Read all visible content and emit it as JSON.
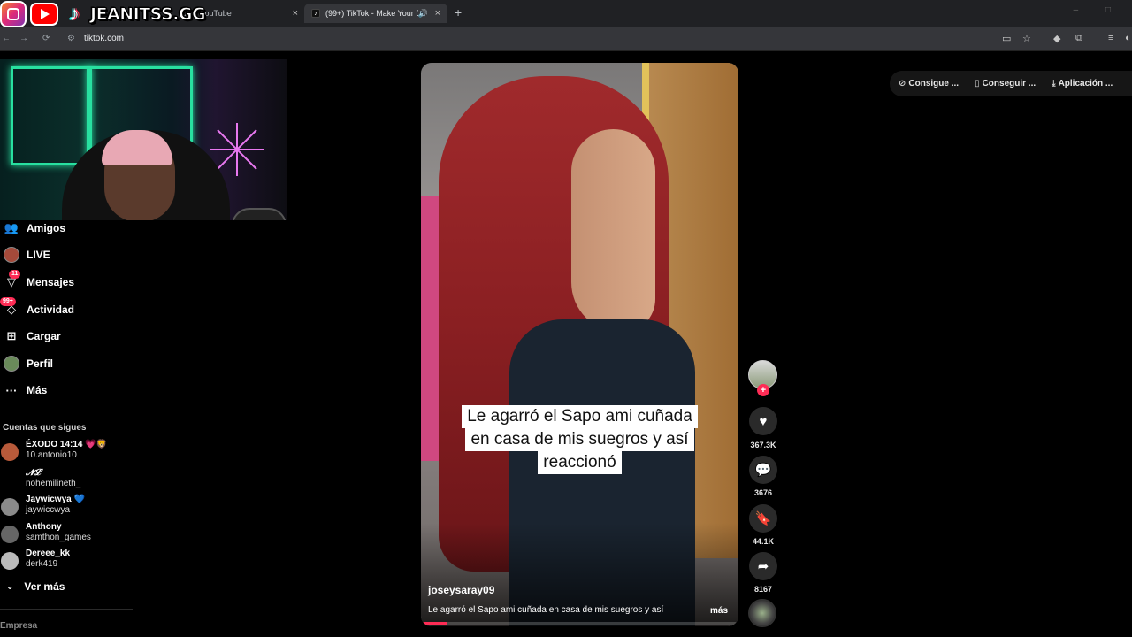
{
  "browser": {
    "tabs": [
      {
        "label": "(532) YouTube",
        "close": "×"
      },
      {
        "label": "(99+) TikTok - Make Your Da",
        "close": "×",
        "favicon": "♪"
      }
    ],
    "new_tab": "+",
    "url": "tiktok.com"
  },
  "overlay": {
    "brand": "JEANITSS.GG"
  },
  "sidebar": {
    "items": [
      {
        "label": "Amigos",
        "icon": "friends-icon"
      },
      {
        "label": "LIVE",
        "icon": "live-icon"
      },
      {
        "label": "Mensajes",
        "icon": "messages-icon",
        "badge": "11"
      },
      {
        "label": "Actividad",
        "icon": "activity-icon",
        "badge": "99+"
      },
      {
        "label": "Cargar",
        "icon": "upload-icon"
      },
      {
        "label": "Perfil",
        "icon": "profile-icon"
      },
      {
        "label": "Más",
        "icon": "more-icon"
      }
    ],
    "following_title": "Cuentas que sigues",
    "following": [
      {
        "name": "ÉXODO 14:14 💗🦁",
        "handle": "10.antonio10"
      },
      {
        "name": "𝓝𝓛",
        "handle": "nohemilineth_"
      },
      {
        "name": "Jaywicwya 💙",
        "handle": "jaywiccwya"
      },
      {
        "name": "Anthony",
        "handle": "samthon_games"
      },
      {
        "name": "Dereee_kk",
        "handle": "derk419"
      }
    ],
    "see_more": "Ver más",
    "footer": "Empresa"
  },
  "video": {
    "caption_lines": [
      "Le agarró el Sapo ami cuñada",
      "en casa de mis suegros y así",
      "reaccionó"
    ],
    "username": "joseysaray09",
    "description": "Le agarró el Sapo ami cuñada en casa de mis suegros y así",
    "more": "más",
    "progress": 0.08
  },
  "actions": {
    "likes": "367.3K",
    "comments": "3676",
    "saves": "44.1K",
    "shares": "8167"
  },
  "top_right": {
    "pills": [
      {
        "label": "Consigue ...",
        "icon": "coin-icon"
      },
      {
        "label": "Conseguir ...",
        "icon": "phone-icon"
      },
      {
        "label": "Aplicación ...",
        "icon": "download-icon"
      }
    ]
  },
  "colors": {
    "accent": "#fe2c55",
    "browser_bg": "#202124",
    "page_bg": "#000000"
  }
}
